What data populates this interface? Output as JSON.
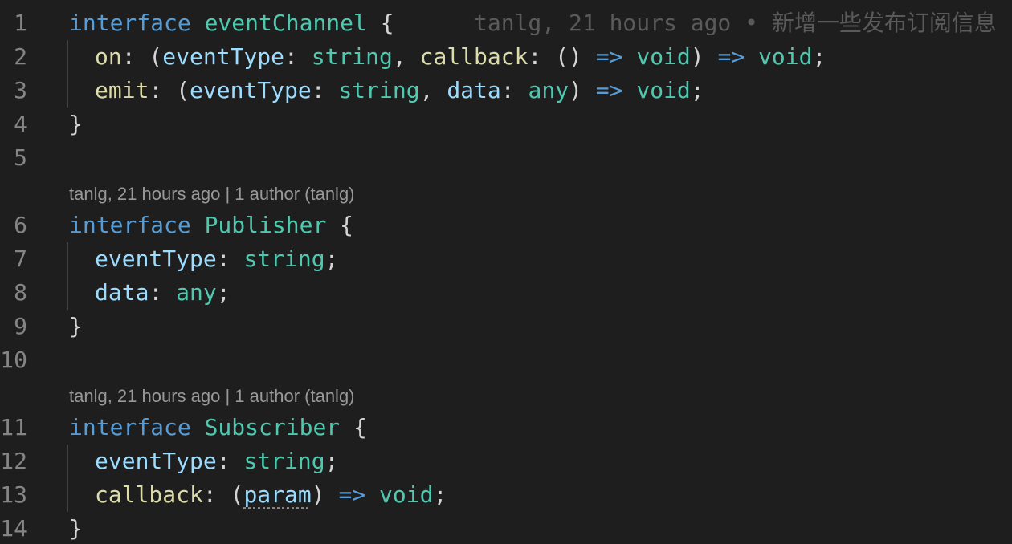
{
  "colors": {
    "background": "#1e1e1e",
    "line_number": "#858585",
    "keyword": "#569cd6",
    "type": "#4ec9b0",
    "property": "#9cdcfe",
    "method": "#dcdcaa",
    "punctuation": "#d4d4d4",
    "codelens": "#999999",
    "blame": "#5a5a5a"
  },
  "codelens": {
    "publisher": "tanlg, 21 hours ago | 1 author (tanlg)",
    "subscriber": "tanlg, 21 hours ago | 1 author (tanlg)"
  },
  "blame_annotation": "tanlg, 21 hours ago • 新增一些发布订阅信息",
  "lines": [
    {
      "num": "1",
      "tokens": [
        {
          "t": "interface",
          "c": "keyword"
        },
        {
          "t": " ",
          "c": "punctuation"
        },
        {
          "t": "eventChannel",
          "c": "type"
        },
        {
          "t": " {",
          "c": "punctuation"
        }
      ]
    },
    {
      "num": "2",
      "indent": 1,
      "tokens": [
        {
          "t": "on",
          "c": "method"
        },
        {
          "t": ": (",
          "c": "punctuation"
        },
        {
          "t": "eventType",
          "c": "property"
        },
        {
          "t": ": ",
          "c": "punctuation"
        },
        {
          "t": "string",
          "c": "type"
        },
        {
          "t": ", ",
          "c": "punctuation"
        },
        {
          "t": "callback",
          "c": "method"
        },
        {
          "t": ": () ",
          "c": "punctuation"
        },
        {
          "t": "=>",
          "c": "keyword"
        },
        {
          "t": " ",
          "c": "punctuation"
        },
        {
          "t": "void",
          "c": "type"
        },
        {
          "t": ") ",
          "c": "punctuation"
        },
        {
          "t": "=>",
          "c": "keyword"
        },
        {
          "t": " ",
          "c": "punctuation"
        },
        {
          "t": "void",
          "c": "type"
        },
        {
          "t": ";",
          "c": "punctuation"
        }
      ]
    },
    {
      "num": "3",
      "indent": 1,
      "tokens": [
        {
          "t": "emit",
          "c": "method"
        },
        {
          "t": ": (",
          "c": "punctuation"
        },
        {
          "t": "eventType",
          "c": "property"
        },
        {
          "t": ": ",
          "c": "punctuation"
        },
        {
          "t": "string",
          "c": "type"
        },
        {
          "t": ", ",
          "c": "punctuation"
        },
        {
          "t": "data",
          "c": "property"
        },
        {
          "t": ": ",
          "c": "punctuation"
        },
        {
          "t": "any",
          "c": "type"
        },
        {
          "t": ") ",
          "c": "punctuation"
        },
        {
          "t": "=>",
          "c": "keyword"
        },
        {
          "t": " ",
          "c": "punctuation"
        },
        {
          "t": "void",
          "c": "type"
        },
        {
          "t": ";",
          "c": "punctuation"
        }
      ]
    },
    {
      "num": "4",
      "tokens": [
        {
          "t": "}",
          "c": "punctuation"
        }
      ]
    },
    {
      "num": "5",
      "tokens": []
    },
    {
      "num": "6",
      "tokens": [
        {
          "t": "interface",
          "c": "keyword"
        },
        {
          "t": " ",
          "c": "punctuation"
        },
        {
          "t": "Publisher",
          "c": "type"
        },
        {
          "t": " {",
          "c": "punctuation"
        }
      ]
    },
    {
      "num": "7",
      "indent": 1,
      "tokens": [
        {
          "t": "eventType",
          "c": "property"
        },
        {
          "t": ": ",
          "c": "punctuation"
        },
        {
          "t": "string",
          "c": "type"
        },
        {
          "t": ";",
          "c": "punctuation"
        }
      ]
    },
    {
      "num": "8",
      "indent": 1,
      "tokens": [
        {
          "t": "data",
          "c": "property"
        },
        {
          "t": ": ",
          "c": "punctuation"
        },
        {
          "t": "any",
          "c": "type"
        },
        {
          "t": ";",
          "c": "punctuation"
        }
      ]
    },
    {
      "num": "9",
      "tokens": [
        {
          "t": "}",
          "c": "punctuation"
        }
      ]
    },
    {
      "num": "10",
      "tokens": []
    },
    {
      "num": "11",
      "tokens": [
        {
          "t": "interface",
          "c": "keyword"
        },
        {
          "t": " ",
          "c": "punctuation"
        },
        {
          "t": "Subscriber",
          "c": "type"
        },
        {
          "t": " {",
          "c": "punctuation"
        }
      ]
    },
    {
      "num": "12",
      "indent": 1,
      "tokens": [
        {
          "t": "eventType",
          "c": "property"
        },
        {
          "t": ": ",
          "c": "punctuation"
        },
        {
          "t": "string",
          "c": "type"
        },
        {
          "t": ";",
          "c": "punctuation"
        }
      ]
    },
    {
      "num": "13",
      "indent": 1,
      "tokens": [
        {
          "t": "callback",
          "c": "method"
        },
        {
          "t": ": (",
          "c": "punctuation"
        },
        {
          "t": "param",
          "c": "property",
          "squiggle": true
        },
        {
          "t": ") ",
          "c": "punctuation"
        },
        {
          "t": "=>",
          "c": "keyword"
        },
        {
          "t": " ",
          "c": "punctuation"
        },
        {
          "t": "void",
          "c": "type"
        },
        {
          "t": ";",
          "c": "punctuation"
        }
      ]
    },
    {
      "num": "14",
      "tokens": [
        {
          "t": "}",
          "c": "punctuation"
        }
      ]
    }
  ]
}
